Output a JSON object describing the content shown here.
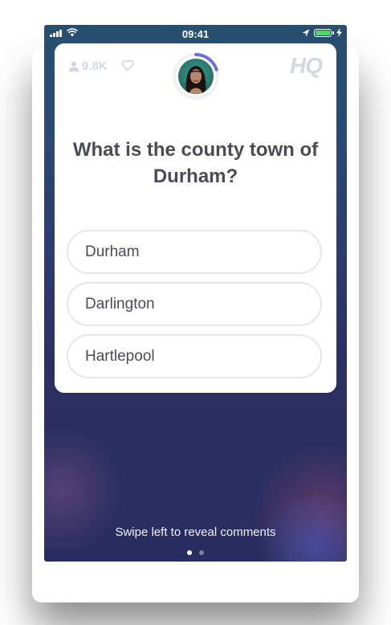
{
  "status_bar": {
    "time": "09:41"
  },
  "header": {
    "viewer_count": "9.8K",
    "logo": "HQ"
  },
  "question": {
    "text": "What is the county town of Durham?"
  },
  "answers": [
    {
      "label": "Durham"
    },
    {
      "label": "Darlington"
    },
    {
      "label": "Hartlepool"
    }
  ],
  "footer": {
    "hint": "Swipe left to reveal comments",
    "pages": 2,
    "active_page": 1
  },
  "icons": {
    "viewers": "person-icon",
    "like": "heart-icon",
    "signal": "signal-icon",
    "wifi": "wifi-icon",
    "location": "location-arrow-icon",
    "battery": "battery-icon",
    "charging": "charging-bolt-icon"
  },
  "colors": {
    "card": "#ffffff",
    "text_dark": "#4b4b55",
    "muted": "#d4d7de",
    "answer_border": "#e4e6ea",
    "timer_ring": "#6e6ae0",
    "battery": "#4cd964",
    "dot_active": "#ffffff",
    "dot_inactive": "#7d7fa3"
  },
  "timer": {
    "progress": 0.2
  }
}
